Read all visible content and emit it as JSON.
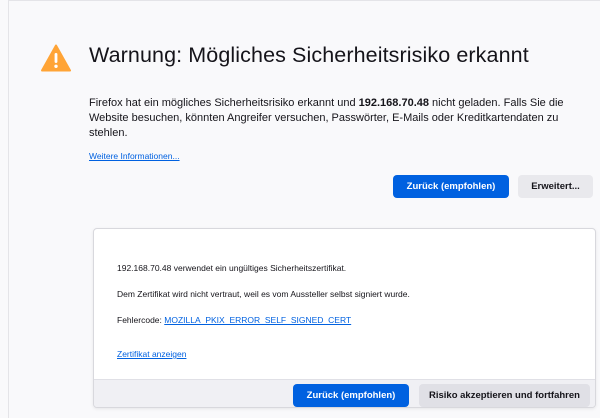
{
  "header": {
    "title": "Warnung: Mögliches Sicherheitsrisiko erkannt"
  },
  "intro": {
    "part1": "Firefox hat ein mögliches Sicherheitsrisiko erkannt und ",
    "host": "192.168.70.48",
    "part2": " nicht geladen. Falls Sie die Website besuchen, könnten Angreifer versuchen, Passwörter, E-Mails oder Kreditkartendaten zu stehlen."
  },
  "more_info_label": "Weitere Informationen...",
  "buttons": {
    "back_label": "Zurück (empfohlen)",
    "advanced_label": "Erweitert...",
    "back_bottom_label": "Zurück (empfohlen)",
    "accept_label": "Risiko akzeptieren und fortfahren"
  },
  "advanced": {
    "line1": "192.168.70.48 verwendet ein ungültiges Sicherheitszertifikat.",
    "line2": "Dem Zertifikat wird nicht vertraut, weil es vom Aussteller selbst signiert wurde.",
    "error_label": "Fehlercode: ",
    "error_code": "MOZILLA_PKIX_ERROR_SELF_SIGNED_CERT",
    "view_cert_label": "Zertifikat anzeigen"
  },
  "colors": {
    "accent": "#0061e0",
    "warning": "#ffa436"
  },
  "icons": {
    "warning": "warning-triangle-icon"
  }
}
